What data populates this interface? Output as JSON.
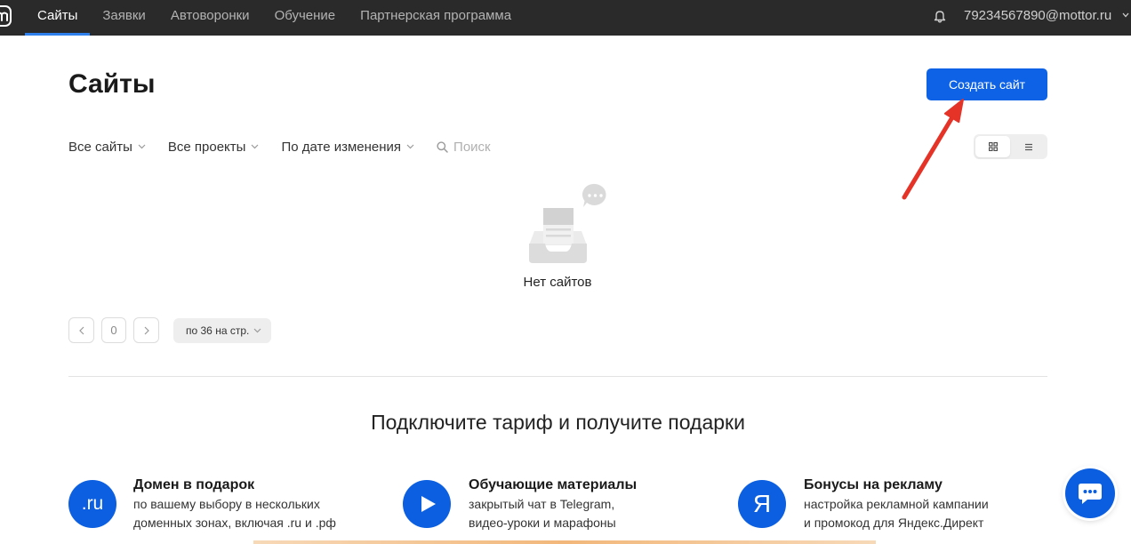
{
  "nav": {
    "logo_icon": "mottor-logo-icon",
    "tabs": [
      {
        "label": "Сайты",
        "active": true
      },
      {
        "label": "Заявки",
        "active": false
      },
      {
        "label": "Автоворонки",
        "active": false
      },
      {
        "label": "Обучение",
        "active": false
      },
      {
        "label": "Партнерская программа",
        "active": false
      }
    ],
    "bell_icon": "bell-icon",
    "account_email": "79234567890@mottor.ru",
    "account_chevron_icon": "chevron-down-icon"
  },
  "page": {
    "title": "Сайты",
    "create_button_label": "Создать сайт"
  },
  "filters": {
    "sites": "Все сайты",
    "projects": "Все проекты",
    "sort": "По дате изменения",
    "search_icon": "search-icon",
    "search_placeholder": "Поиск"
  },
  "view_toggle": {
    "options": [
      "grid-icon",
      "list-icon"
    ],
    "active_index": 0
  },
  "empty_state": {
    "icon": "empty-inbox-icon",
    "text": "Нет сайтов"
  },
  "pagination": {
    "prev_icon": "chevron-left-icon",
    "page": "0",
    "next_icon": "chevron-right-icon",
    "per_page": "по 36 на стр."
  },
  "promo": {
    "heading": "Подключите тариф и получите подарки",
    "items": [
      {
        "badge": ".ru",
        "title": "Домен в подарок",
        "desc_lines": [
          "по вашему выбору в нескольких",
          "доменных зонах, включая .ru и .рф"
        ]
      },
      {
        "badge_icon": "play-icon",
        "title": "Обучающие материалы",
        "desc_lines": [
          "закрытый чат в Telegram,",
          "видео-уроки и марафоны"
        ]
      },
      {
        "badge": "Я",
        "title": "Бонусы на рекламу",
        "desc_lines": [
          "настройка рекламной кампании",
          "и промокод для Яндекс.Директ"
        ]
      }
    ]
  },
  "chat_widget_icon": "chat-bubble-icon",
  "colors": {
    "nav_bg": "#2a2a2a",
    "accent": "#0d62e6",
    "tab_underline": "#2f80ed",
    "badge_blue": "#0b5fe0",
    "annotation_arrow": "#e53328"
  }
}
